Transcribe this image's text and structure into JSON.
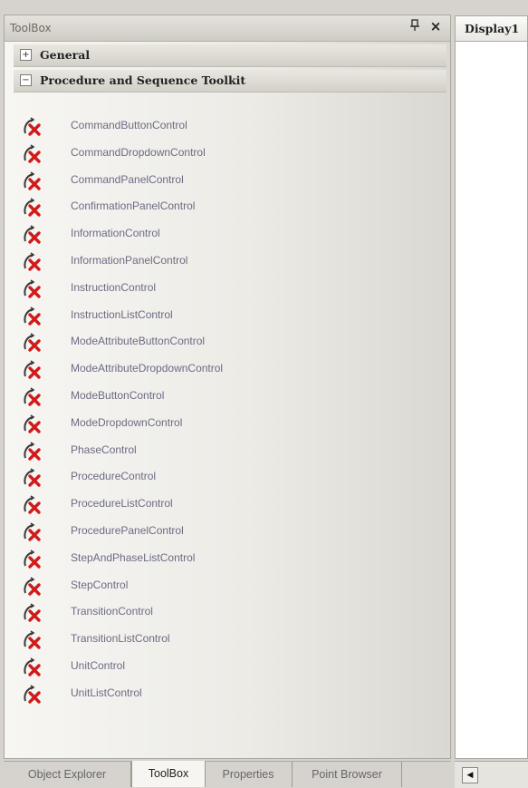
{
  "toolbox": {
    "title": "ToolBox",
    "pin_glyph": "p",
    "close_glyph": "×",
    "sections": [
      {
        "label": "General",
        "state": "+"
      },
      {
        "label": "Procedure and Sequence Toolkit",
        "state": "−"
      }
    ],
    "items": [
      {
        "label": "CommandButtonControl",
        "icon": "control-x-icon"
      },
      {
        "label": "CommandDropdownControl",
        "icon": "control-x-icon"
      },
      {
        "label": "CommandPanelControl",
        "icon": "control-x-icon"
      },
      {
        "label": "ConfirmationPanelControl",
        "icon": "control-x-icon"
      },
      {
        "label": "InformationControl",
        "icon": "control-x-icon"
      },
      {
        "label": "InformationPanelControl",
        "icon": "control-x-icon"
      },
      {
        "label": "InstructionControl",
        "icon": "control-x-icon"
      },
      {
        "label": "InstructionListControl",
        "icon": "control-x-icon"
      },
      {
        "label": "ModeAttributeButtonControl",
        "icon": "control-x-icon"
      },
      {
        "label": "ModeAttributeDropdownControl",
        "icon": "control-x-icon"
      },
      {
        "label": "ModeButtonControl",
        "icon": "control-x-icon"
      },
      {
        "label": "ModeDropdownControl",
        "icon": "control-x-icon"
      },
      {
        "label": "PhaseControl",
        "icon": "control-x-icon"
      },
      {
        "label": "ProcedureControl",
        "icon": "control-x-icon"
      },
      {
        "label": "ProcedureListControl",
        "icon": "control-x-icon"
      },
      {
        "label": "ProcedurePanelControl",
        "icon": "control-x-icon"
      },
      {
        "label": "StepAndPhaseListControl",
        "icon": "control-x-icon"
      },
      {
        "label": "StepControl",
        "icon": "control-x-icon"
      },
      {
        "label": "TransitionControl",
        "icon": "control-x-icon"
      },
      {
        "label": "TransitionListControl",
        "icon": "control-x-icon"
      },
      {
        "label": "UnitControl",
        "icon": "control-x-icon"
      },
      {
        "label": "UnitListControl",
        "icon": "control-x-icon"
      }
    ]
  },
  "bottom_tabs": [
    {
      "label": "Object Explorer",
      "active": false
    },
    {
      "label": "ToolBox",
      "active": true
    },
    {
      "label": "Properties",
      "active": false
    },
    {
      "label": "Point Browser",
      "active": false
    }
  ],
  "document": {
    "tab_label": "Display1",
    "scroll_left_glyph": "◀"
  },
  "colors": {
    "icon_red": "#d11a1a",
    "icon_dark": "#3a3a3a",
    "item_text": "#6e6a83"
  }
}
